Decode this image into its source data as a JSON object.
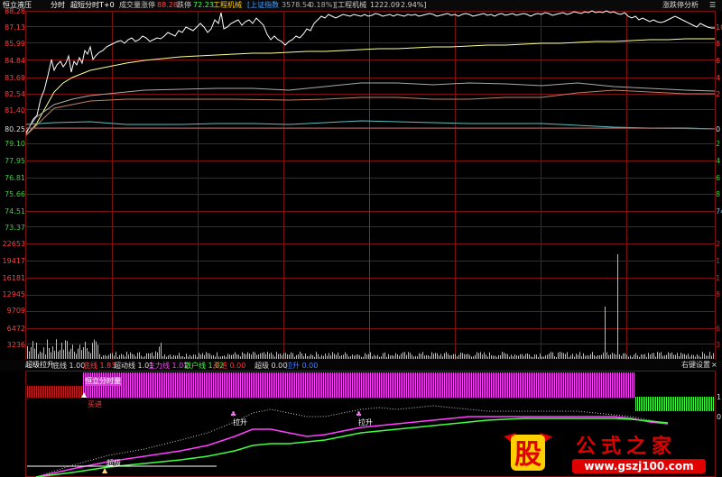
{
  "header": {
    "title": "恒立液压",
    "mode_tab": "分时",
    "indicator_tab": "超短分时T+0",
    "volume_label": "成交量",
    "limit_up_label": "涨停",
    "limit_up_value": "88.28",
    "limit_down_label": "跌停",
    "limit_down_value": "72.23",
    "sector_name": "工程机械",
    "index_label": "[上证指数",
    "index_value": "3578.54",
    "index_change": "-0.18%]",
    "sector_bracket": "[工程机械",
    "sector_value": "1222.09",
    "sector_change": "2.94%]",
    "analysis_button": "涨跌停分析"
  },
  "price_axis": {
    "left_labels": [
      "88.28",
      "87.13",
      "85.99",
      "84.84",
      "83.69",
      "82.54",
      "81.40",
      "80.25",
      "79.10",
      "77.95",
      "76.81",
      "75.66",
      "74.51",
      "73.37"
    ],
    "right_labels": [
      "10",
      "8",
      "6",
      "4",
      "2",
      "0",
      "2",
      "4",
      "6",
      "8",
      "74"
    ]
  },
  "volume_axis": {
    "labels": [
      "22653",
      "19417",
      "16181",
      "12945",
      "9709",
      "6472",
      "3236"
    ],
    "right_labels": [
      "2",
      "1",
      "1",
      "8",
      "6",
      "3"
    ]
  },
  "indicator_bar": {
    "name": "超级拉升",
    "items": [
      {
        "label": "底线",
        "value": "1.00",
        "color": "#dddddd"
      },
      {
        "label": "底线",
        "value": "1.83",
        "color": "#ff4040"
      },
      {
        "label": "超动线",
        "value": "1.01",
        "color": "#dddddd"
      },
      {
        "label": "主力线",
        "value": "1.01",
        "color": "#ff40ff"
      },
      {
        "label": "散户线",
        "value": "1.02",
        "color": "#40ff40"
      },
      {
        "label": "买进",
        "value": "0.00",
        "color": "#ff3030"
      },
      {
        "label": "超级",
        "value": "0.00",
        "color": "#dddddd"
      },
      {
        "label": "拉升",
        "value": "0.00",
        "color": "#4080ff"
      }
    ],
    "settings_button": "右键设置"
  },
  "annotations": {
    "panel_label": "恒立分时量",
    "buy": "买进",
    "lift1": "拉升",
    "lift2": "拉升",
    "super": "超级",
    "right_scale": [
      "1",
      "0"
    ]
  },
  "watermark": {
    "badge_char": "股",
    "brand": "公式之家",
    "url": "www.gszj100.com"
  },
  "colors": {
    "grid": "#7a1010",
    "price_line": "#ffffff",
    "avg_line": "#ffff80",
    "magenta": "#ff40ff",
    "green_bar": "#40ff40",
    "red_bar": "#c02020"
  }
}
